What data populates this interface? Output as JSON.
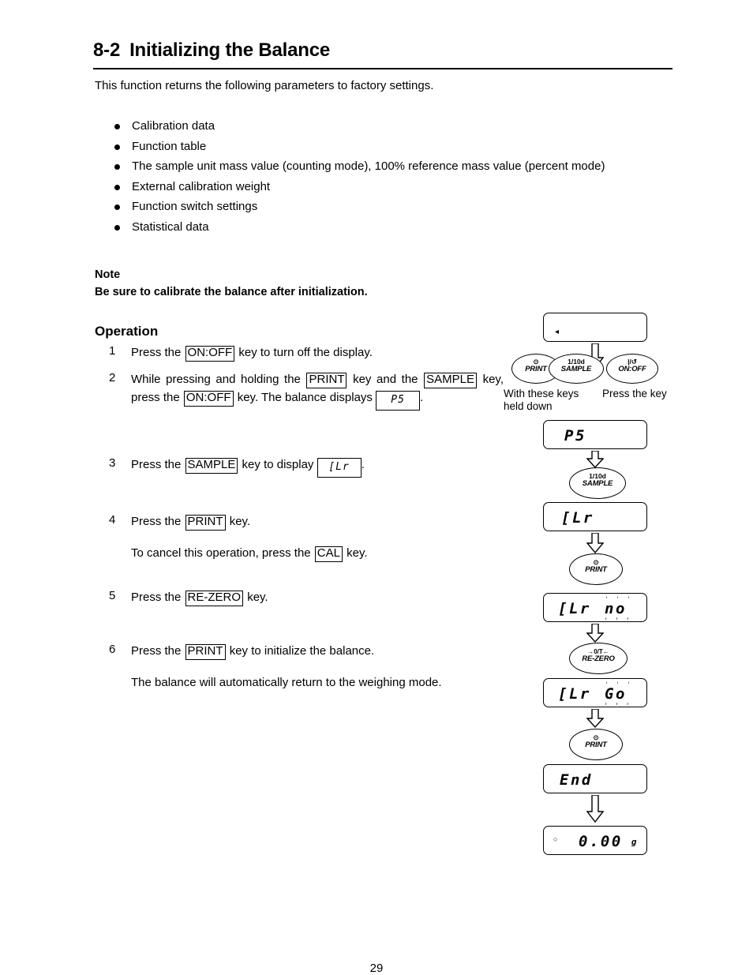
{
  "document": {
    "section_number": "8-2",
    "section_title": "Initializing the Balance",
    "intro": "This function returns the following parameters to factory settings.",
    "page_number": "29"
  },
  "parameters_list": [
    "Calibration data",
    "Function table",
    "The sample unit mass value (counting mode), 100% reference mass value (percent mode)",
    "External calibration weight",
    "Function switch settings",
    "Statistical data"
  ],
  "note": {
    "label": "Note",
    "text": "Be sure to calibrate the balance after initialization."
  },
  "operation": {
    "heading": "Operation",
    "steps": [
      {
        "number": "1",
        "parts": [
          {
            "t": "text",
            "v": "Press the "
          },
          {
            "t": "key",
            "v": "ON:OFF"
          },
          {
            "t": "text",
            "v": " key to turn off the display."
          }
        ]
      },
      {
        "number": "2",
        "parts": [
          {
            "t": "text",
            "v": "While pressing and holding the "
          },
          {
            "t": "key",
            "v": "PRINT"
          },
          {
            "t": "text",
            "v": " key and the "
          },
          {
            "t": "key",
            "v": "SAMPLE"
          },
          {
            "t": "text",
            "v": " key, press the "
          },
          {
            "t": "key",
            "v": "ON:OFF"
          },
          {
            "t": "text",
            "v": " key. The balance displays "
          },
          {
            "t": "lcd",
            "v": "P5"
          },
          {
            "t": "text",
            "v": "."
          }
        ]
      },
      {
        "number": "3",
        "parts": [
          {
            "t": "text",
            "v": "Press the "
          },
          {
            "t": "key",
            "v": "SAMPLE"
          },
          {
            "t": "text",
            "v": " key to display "
          },
          {
            "t": "lcd",
            "v": "[Lr"
          },
          {
            "t": "text",
            "v": "."
          }
        ]
      },
      {
        "number": "4",
        "parts": [
          {
            "t": "text",
            "v": "Press the "
          },
          {
            "t": "key",
            "v": "PRINT"
          },
          {
            "t": "text",
            "v": " key."
          }
        ],
        "sub": [
          {
            "t": "text",
            "v": "To cancel this operation, press the "
          },
          {
            "t": "key",
            "v": "CAL"
          },
          {
            "t": "text",
            "v": " key."
          }
        ]
      },
      {
        "number": "5",
        "parts": [
          {
            "t": "text",
            "v": "Press the "
          },
          {
            "t": "key",
            "v": "RE-ZERO"
          },
          {
            "t": "text",
            "v": " key."
          }
        ]
      },
      {
        "number": "6",
        "parts": [
          {
            "t": "text",
            "v": "Press the "
          },
          {
            "t": "key",
            "v": "PRINT"
          },
          {
            "t": "text",
            "v": " key to initialize the balance."
          }
        ],
        "sub": [
          {
            "t": "text",
            "v": "The balance will automatically return to the weighing mode."
          }
        ]
      }
    ]
  },
  "flow_diagram": {
    "captions": {
      "held_keys": "With these keys\nheld down",
      "press_key": "Press the key"
    },
    "keys": {
      "print": {
        "top_symbol": "⊙",
        "label": "PRINT"
      },
      "sample": {
        "top_symbol": "1/10d",
        "label": "SAMPLE"
      },
      "onoff": {
        "top_symbol": "|/↺",
        "label": "ON:OFF"
      },
      "rezero": {
        "top_symbol": "→0/T←",
        "label": "RE-ZERO"
      }
    },
    "displays": [
      {
        "id": "blank",
        "text": "",
        "marker": "◂"
      },
      {
        "id": "ps",
        "text": "P5"
      },
      {
        "id": "clr",
        "text": "[Lr"
      },
      {
        "id": "clr-no",
        "text": "[Lr",
        "value": "no",
        "blinking": true
      },
      {
        "id": "clr-go",
        "text": "[Lr",
        "value": "Go",
        "blinking": true
      },
      {
        "id": "end",
        "text": "End"
      },
      {
        "id": "weighing",
        "stable_mark": "○",
        "text": "0.00",
        "unit": "g"
      }
    ]
  }
}
